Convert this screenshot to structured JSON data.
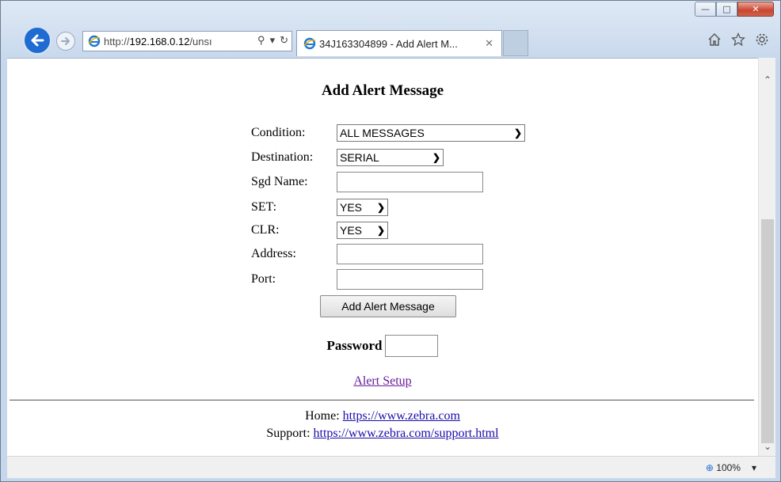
{
  "browser": {
    "url_prefix": "http://",
    "url_host": "192.168.0.12",
    "url_rest": "/unsı",
    "tab_title": "34J163304899 - Add Alert M...",
    "zoom": "100%"
  },
  "page": {
    "title": "Add Alert Message",
    "fields": {
      "condition_label": "Condition:",
      "condition_value": "ALL MESSAGES",
      "destination_label": "Destination:",
      "destination_value": "SERIAL",
      "sgd_label": "Sgd Name:",
      "sgd_value": "",
      "set_label": "SET:",
      "set_value": "YES",
      "clr_label": "CLR:",
      "clr_value": "YES",
      "address_label": "Address:",
      "address_value": "",
      "port_label": "Port:",
      "port_value": ""
    },
    "submit_label": "Add Alert Message",
    "password_label": "Password",
    "alert_setup_link": "Alert Setup",
    "home_label": "Home:",
    "home_url": "https://www.zebra.com",
    "support_label": "Support:",
    "support_url": "https://www.zebra.com/support.html"
  }
}
